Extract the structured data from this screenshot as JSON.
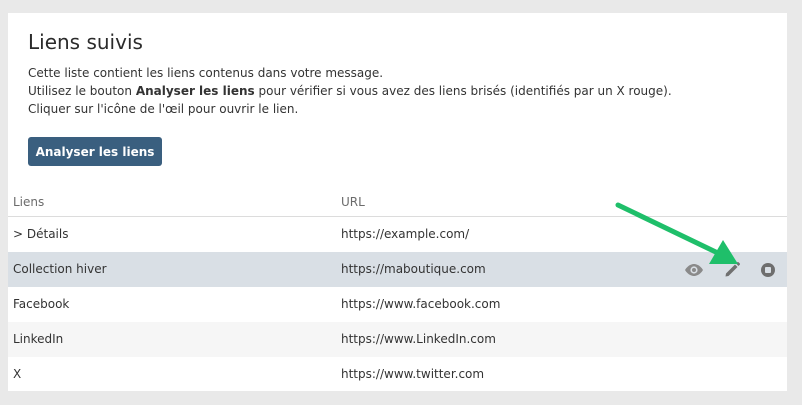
{
  "header": {
    "title": "Liens suivis",
    "line1": "Cette liste contient les liens contenus dans votre message.",
    "line2_prefix": "Utilisez le bouton ",
    "line2_bold": "Analyser les liens",
    "line2_suffix": " pour vérifier si vous avez des liens brisés (identifiés par un X rouge).",
    "line3": "Cliquer sur l'icône de l'œil pour ouvrir le lien."
  },
  "analyze_button": "Analyser les liens",
  "table": {
    "col_links": "Liens",
    "col_url": "URL",
    "rows": [
      {
        "link": "> Détails",
        "url": "https://example.com/"
      },
      {
        "link": "Collection hiver",
        "url": "https://maboutique.com"
      },
      {
        "link": "Facebook",
        "url": "https://www.facebook.com"
      },
      {
        "link": "LinkedIn",
        "url": "https://www.LinkedIn.com"
      },
      {
        "link": "X",
        "url": "https://www.twitter.com"
      }
    ]
  },
  "icons": {
    "view": "eye-icon",
    "edit": "pencil-icon",
    "stop": "stop-icon",
    "annotation": "green-arrow"
  },
  "colors": {
    "button_bg": "#3a5f7f",
    "highlight_row": "#d9dfe5",
    "arrow": "#1fbf6a"
  }
}
